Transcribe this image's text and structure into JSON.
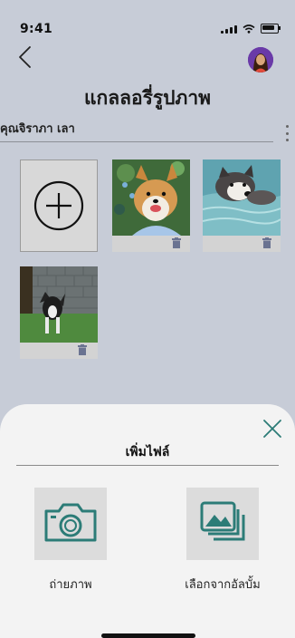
{
  "status": {
    "time": "9:41"
  },
  "header": {
    "title": "แกลลอรี่รูปภาพ",
    "owner": "คุณจิราภา เลา"
  },
  "gallery": {
    "photos": [
      {
        "name": "corgi",
        "alt": "corgi-dog-photo"
      },
      {
        "name": "husky",
        "alt": "husky-swimming-photo"
      },
      {
        "name": "border-collie",
        "alt": "dog-standing-photo"
      }
    ]
  },
  "sheet": {
    "title": "เพิ่มไฟล์",
    "options": [
      {
        "label": "ถ่ายภาพ",
        "icon": "camera-icon"
      },
      {
        "label": "เลือกจากอัลบั้ม",
        "icon": "album-icon"
      }
    ]
  },
  "colors": {
    "accent": "#2c7c77",
    "background": "#c7ccd7",
    "sheet": "#f3f3f3"
  }
}
